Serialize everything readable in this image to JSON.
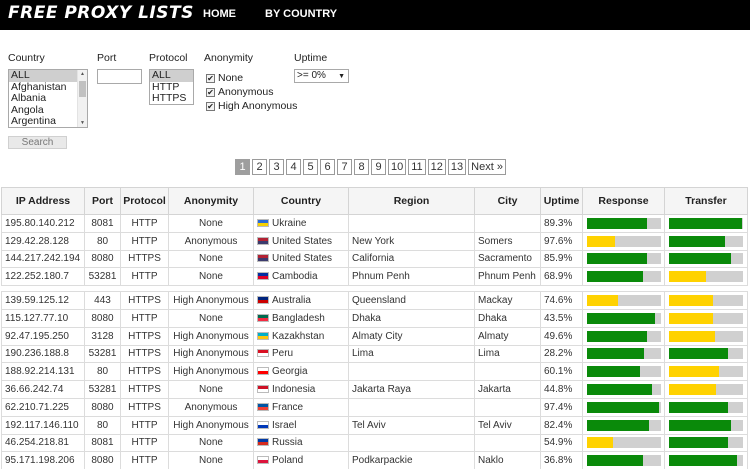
{
  "header": {
    "logo": "FREE PROXY LISTS",
    "nav": [
      "HOME",
      "BY COUNTRY"
    ]
  },
  "filters": {
    "country_label": "Country",
    "country_options": [
      "ALL",
      "Afghanistan",
      "Albania",
      "Angola",
      "Argentina"
    ],
    "port_label": "Port",
    "port_value": "",
    "protocol_label": "Protocol",
    "protocol_options": [
      "ALL",
      "HTTP",
      "HTTPS"
    ],
    "anonymity_label": "Anonymity",
    "anonymity_options": [
      "None",
      "Anonymous",
      "High Anonymous"
    ],
    "uptime_label": "Uptime",
    "uptime_value": ">= 0%",
    "search_label": "Search"
  },
  "pagination": {
    "pages": [
      "1",
      "2",
      "3",
      "4",
      "5",
      "6",
      "7",
      "8",
      "9",
      "10",
      "11",
      "12",
      "13"
    ],
    "active": "1",
    "next_label": "Next »"
  },
  "table": {
    "headers": [
      "IP Address",
      "Port",
      "Protocol",
      "Anonymity",
      "Country",
      "Region",
      "City",
      "Uptime",
      "Response",
      "Transfer"
    ],
    "colors": {
      "green": "#0a8a0a",
      "yellow": "#ffd200",
      "empty": "#d0d0d0"
    },
    "rows": [
      {
        "ip": "195.80.140.212",
        "port": "8081",
        "protocol": "HTTP",
        "anonymity": "None",
        "country": "Ukraine",
        "flag": [
          "#2a6bd6",
          "#f7d100"
        ],
        "region": "",
        "city": "",
        "uptime": "89.3%",
        "response": 0.82,
        "response_color": "green",
        "transfer": 0.98,
        "transfer_color": "green"
      },
      {
        "ip": "129.42.28.128",
        "port": "80",
        "protocol": "HTTP",
        "anonymity": "Anonymous",
        "country": "United States",
        "flag": [
          "#b22234",
          "#3c3b6e"
        ],
        "region": "New York",
        "city": "Somers",
        "uptime": "97.6%",
        "response": 0.38,
        "response_color": "yellow",
        "transfer": 0.76,
        "transfer_color": "green"
      },
      {
        "ip": "144.217.242.194",
        "port": "8080",
        "protocol": "HTTPS",
        "anonymity": "None",
        "country": "United States",
        "flag": [
          "#b22234",
          "#3c3b6e"
        ],
        "region": "California",
        "city": "Sacramento",
        "uptime": "85.9%",
        "response": 0.82,
        "response_color": "green",
        "transfer": 0.84,
        "transfer_color": "green"
      },
      {
        "ip": "122.252.180.7",
        "port": "53281",
        "protocol": "HTTP",
        "anonymity": "None",
        "country": "Cambodia",
        "flag": [
          "#032ea1",
          "#e00025"
        ],
        "region": "Phnum Penh",
        "city": "Phnum Penh",
        "uptime": "68.9%",
        "response": 0.76,
        "response_color": "green",
        "transfer": 0.5,
        "transfer_color": "yellow"
      },
      {
        "gap": true
      },
      {
        "ip": "139.59.125.12",
        "port": "443",
        "protocol": "HTTPS",
        "anonymity": "High Anonymous",
        "country": "Australia",
        "flag": [
          "#00247d",
          "#cc0000"
        ],
        "region": "Queensland",
        "city": "Mackay",
        "uptime": "74.6%",
        "response": 0.42,
        "response_color": "yellow",
        "transfer": 0.6,
        "transfer_color": "yellow"
      },
      {
        "ip": "115.127.77.10",
        "port": "8080",
        "protocol": "HTTP",
        "anonymity": "None",
        "country": "Bangladesh",
        "flag": [
          "#006a4e",
          "#f42a41"
        ],
        "region": "Dhaka",
        "city": "Dhaka",
        "uptime": "43.5%",
        "response": 0.92,
        "response_color": "green",
        "transfer": 0.6,
        "transfer_color": "yellow"
      },
      {
        "ip": "92.47.195.250",
        "port": "3128",
        "protocol": "HTTPS",
        "anonymity": "High Anonymous",
        "country": "Kazakhstan",
        "flag": [
          "#00afca",
          "#fec50c"
        ],
        "region": "Almaty City",
        "city": "Almaty",
        "uptime": "49.6%",
        "response": 0.82,
        "response_color": "green",
        "transfer": 0.62,
        "transfer_color": "yellow"
      },
      {
        "ip": "190.236.188.8",
        "port": "53281",
        "protocol": "HTTPS",
        "anonymity": "High Anonymous",
        "country": "Peru",
        "flag": [
          "#d91023",
          "#ffffff"
        ],
        "region": "Lima",
        "city": "Lima",
        "uptime": "28.2%",
        "response": 0.78,
        "response_color": "green",
        "transfer": 0.8,
        "transfer_color": "green"
      },
      {
        "ip": "188.92.214.131",
        "port": "80",
        "protocol": "HTTPS",
        "anonymity": "High Anonymous",
        "country": "Georgia",
        "flag": [
          "#ffffff",
          "#ff0000"
        ],
        "region": "",
        "city": "",
        "uptime": "60.1%",
        "response": 0.72,
        "response_color": "green",
        "transfer": 0.68,
        "transfer_color": "yellow"
      },
      {
        "ip": "36.66.242.74",
        "port": "53281",
        "protocol": "HTTPS",
        "anonymity": "None",
        "country": "Indonesia",
        "flag": [
          "#ce1126",
          "#ffffff"
        ],
        "region": "Jakarta Raya",
        "city": "Jakarta",
        "uptime": "44.8%",
        "response": 0.88,
        "response_color": "green",
        "transfer": 0.64,
        "transfer_color": "yellow"
      },
      {
        "ip": "62.210.71.225",
        "port": "8080",
        "protocol": "HTTPS",
        "anonymity": "Anonymous",
        "country": "France",
        "flag": [
          "#0055a4",
          "#ef4135"
        ],
        "region": "",
        "city": "",
        "uptime": "97.4%",
        "response": 0.98,
        "response_color": "green",
        "transfer": 0.8,
        "transfer_color": "green"
      },
      {
        "ip": "192.117.146.110",
        "port": "80",
        "protocol": "HTTP",
        "anonymity": "High Anonymous",
        "country": "Israel",
        "flag": [
          "#ffffff",
          "#0038b8"
        ],
        "region": "Tel Aviv",
        "city": "Tel Aviv",
        "uptime": "82.4%",
        "response": 0.84,
        "response_color": "green",
        "transfer": 0.84,
        "transfer_color": "green"
      },
      {
        "ip": "46.254.218.81",
        "port": "8081",
        "protocol": "HTTP",
        "anonymity": "None",
        "country": "Russia",
        "flag": [
          "#0039a6",
          "#d52b1e"
        ],
        "region": "",
        "city": "",
        "uptime": "54.9%",
        "response": 0.36,
        "response_color": "yellow",
        "transfer": 0.8,
        "transfer_color": "green"
      },
      {
        "ip": "95.171.198.206",
        "port": "8080",
        "protocol": "HTTP",
        "anonymity": "None",
        "country": "Poland",
        "flag": [
          "#ffffff",
          "#dc143c"
        ],
        "region": "Podkarpackie",
        "city": "Naklo",
        "uptime": "36.8%",
        "response": 0.76,
        "response_color": "green",
        "transfer": 0.92,
        "transfer_color": "green"
      }
    ]
  }
}
